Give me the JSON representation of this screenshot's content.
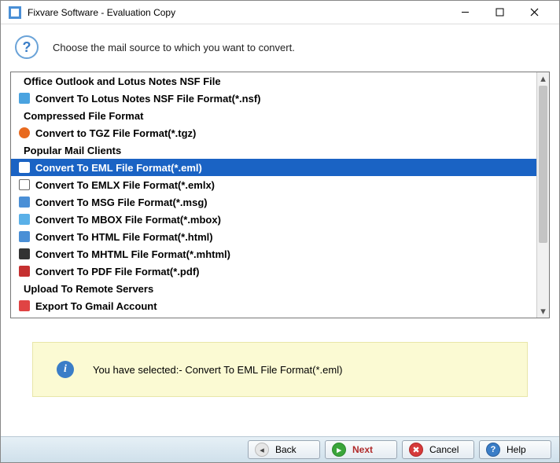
{
  "window": {
    "title": "Fixvare Software - Evaluation Copy"
  },
  "header": {
    "instruction": "Choose the mail source to which you want to convert."
  },
  "list": {
    "rows": [
      {
        "type": "header",
        "label": "Office Outlook and Lotus Notes NSF File"
      },
      {
        "type": "item",
        "label": "Convert To Lotus Notes NSF File Format(*.nsf)",
        "icon": "nsf"
      },
      {
        "type": "header",
        "label": "Compressed File Format"
      },
      {
        "type": "item",
        "label": "Convert to TGZ File Format(*.tgz)",
        "icon": "tgz"
      },
      {
        "type": "header",
        "label": "Popular Mail Clients"
      },
      {
        "type": "item",
        "label": "Convert To EML File Format(*.eml)",
        "icon": "eml",
        "selected": true
      },
      {
        "type": "item",
        "label": "Convert To EMLX File Format(*.emlx)",
        "icon": "emlx"
      },
      {
        "type": "item",
        "label": "Convert To MSG File Format(*.msg)",
        "icon": "msg"
      },
      {
        "type": "item",
        "label": "Convert To MBOX File Format(*.mbox)",
        "icon": "mbox"
      },
      {
        "type": "item",
        "label": "Convert To HTML File Format(*.html)",
        "icon": "html"
      },
      {
        "type": "item",
        "label": "Convert To MHTML File Format(*.mhtml)",
        "icon": "mhtml"
      },
      {
        "type": "item",
        "label": "Convert To PDF File Format(*.pdf)",
        "icon": "pdf"
      },
      {
        "type": "header",
        "label": "Upload To Remote Servers"
      },
      {
        "type": "item",
        "label": "Export To Gmail Account",
        "icon": "gmail"
      }
    ]
  },
  "status": {
    "message": "You have selected:- Convert To EML File Format(*.eml)"
  },
  "footer": {
    "back": "Back",
    "next": "Next",
    "cancel": "Cancel",
    "help": "Help"
  }
}
